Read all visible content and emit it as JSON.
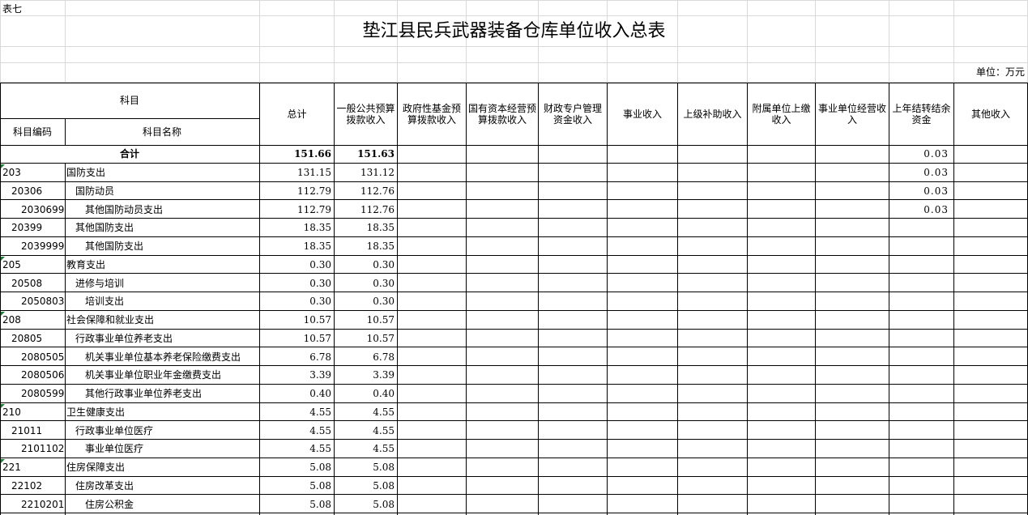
{
  "sheet": {
    "table_no": "表七",
    "title": "垫江县民兵武器装备仓库单位收入总表",
    "unit": "单位：万元"
  },
  "header": {
    "subject": "科目",
    "code": "科目编码",
    "name": "科目名称",
    "columns": [
      "总计",
      "一般公共预算拨款收入",
      "政府性基金预算拨款收入",
      "国有资本经营预算拨款收入",
      "财政专户管理资金收入",
      "事业收入",
      "上级补助收入",
      "附属单位上缴收入",
      "事业单位经营收入",
      "上年结转结余资金",
      "其他收入"
    ]
  },
  "rows": [
    {
      "code": "",
      "name": "合计",
      "total": "151.66",
      "general": "151.63",
      "carry": "0.03",
      "level": 0
    },
    {
      "code": "203",
      "name": "国防支出",
      "total": "131.15",
      "general": "131.12",
      "carry": "0.03",
      "level": 1
    },
    {
      "code": "20306",
      "name": "国防动员",
      "total": "112.79",
      "general": "112.76",
      "carry": "0.03",
      "level": 2
    },
    {
      "code": "2030699",
      "name": "其他国防动员支出",
      "total": "112.79",
      "general": "112.76",
      "carry": "0.03",
      "level": 3
    },
    {
      "code": "20399",
      "name": "其他国防支出",
      "total": "18.35",
      "general": "18.35",
      "carry": "",
      "level": 2
    },
    {
      "code": "2039999",
      "name": "其他国防支出",
      "total": "18.35",
      "general": "18.35",
      "carry": "",
      "level": 3
    },
    {
      "code": "205",
      "name": "教育支出",
      "total": "0.30",
      "general": "0.30",
      "carry": "",
      "level": 1
    },
    {
      "code": "20508",
      "name": "进修与培训",
      "total": "0.30",
      "general": "0.30",
      "carry": "",
      "level": 2
    },
    {
      "code": "2050803",
      "name": "培训支出",
      "total": "0.30",
      "general": "0.30",
      "carry": "",
      "level": 3
    },
    {
      "code": "208",
      "name": "社会保障和就业支出",
      "total": "10.57",
      "general": "10.57",
      "carry": "",
      "level": 1
    },
    {
      "code": "20805",
      "name": "行政事业单位养老支出",
      "total": "10.57",
      "general": "10.57",
      "carry": "",
      "level": 2
    },
    {
      "code": "2080505",
      "name": "机关事业单位基本养老保险缴费支出",
      "total": "6.78",
      "general": "6.78",
      "carry": "",
      "level": 3
    },
    {
      "code": "2080506",
      "name": "机关事业单位职业年金缴费支出",
      "total": "3.39",
      "general": "3.39",
      "carry": "",
      "level": 3
    },
    {
      "code": "2080599",
      "name": "其他行政事业单位养老支出",
      "total": "0.40",
      "general": "0.40",
      "carry": "",
      "level": 3
    },
    {
      "code": "210",
      "name": "卫生健康支出",
      "total": "4.55",
      "general": "4.55",
      "carry": "",
      "level": 1
    },
    {
      "code": "21011",
      "name": "行政事业单位医疗",
      "total": "4.55",
      "general": "4.55",
      "carry": "",
      "level": 2
    },
    {
      "code": "2101102",
      "name": "事业单位医疗",
      "total": "4.55",
      "general": "4.55",
      "carry": "",
      "level": 3
    },
    {
      "code": "221",
      "name": "住房保障支出",
      "total": "5.08",
      "general": "5.08",
      "carry": "",
      "level": 1
    },
    {
      "code": "22102",
      "name": "住房改革支出",
      "total": "5.08",
      "general": "5.08",
      "carry": "",
      "level": 2
    },
    {
      "code": "2210201",
      "name": "住房公积金",
      "total": "5.08",
      "general": "5.08",
      "carry": "",
      "level": 3
    }
  ]
}
